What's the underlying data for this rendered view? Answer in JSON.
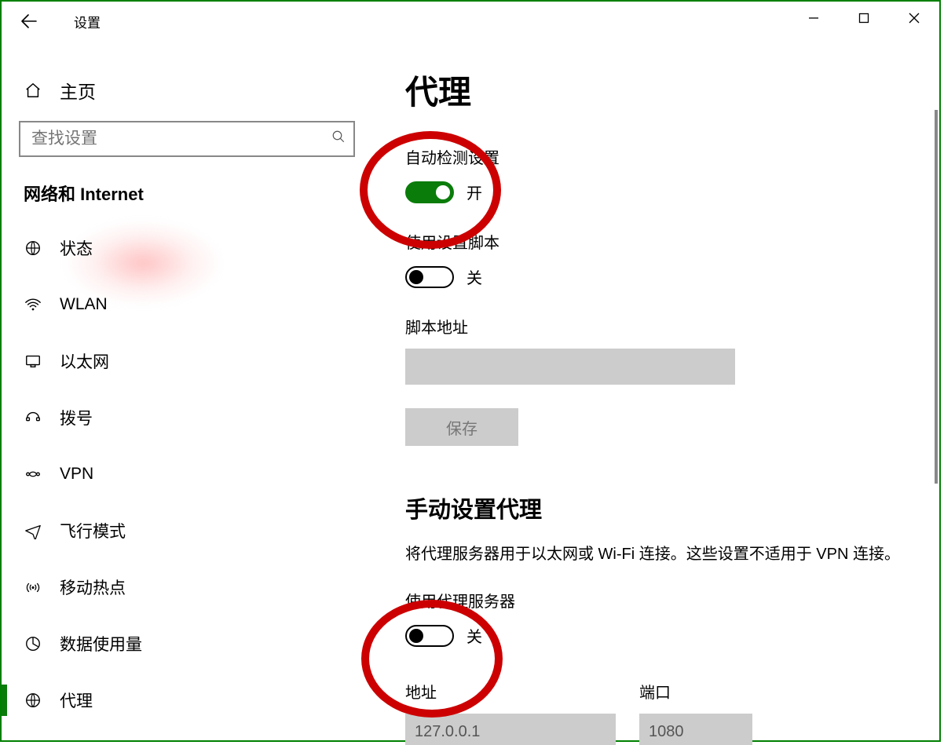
{
  "window": {
    "title": "设置"
  },
  "sidebar": {
    "home": "主页",
    "search_placeholder": "查找设置",
    "category": "网络和 Internet",
    "items": [
      {
        "label": "状态",
        "icon": "status-icon"
      },
      {
        "label": "WLAN",
        "icon": "wifi-icon"
      },
      {
        "label": "以太网",
        "icon": "ethernet-icon"
      },
      {
        "label": "拨号",
        "icon": "dialup-icon"
      },
      {
        "label": "VPN",
        "icon": "vpn-icon"
      },
      {
        "label": "飞行模式",
        "icon": "airplane-icon"
      },
      {
        "label": "移动热点",
        "icon": "hotspot-icon"
      },
      {
        "label": "数据使用量",
        "icon": "datausage-icon"
      },
      {
        "label": "代理",
        "icon": "proxy-icon",
        "active": true
      }
    ]
  },
  "content": {
    "page_title": "代理",
    "auto_detect_label": "自动检测设置",
    "auto_detect_state_text": "开",
    "use_script_label": "使用设置脚本",
    "use_script_state_text": "关",
    "script_address_label": "脚本地址",
    "script_address_value": "",
    "save_label": "保存",
    "manual_title": "手动设置代理",
    "manual_desc": "将代理服务器用于以太网或 Wi-Fi 连接。这些设置不适用于 VPN 连接。",
    "use_proxy_label": "使用代理服务器",
    "use_proxy_state_text": "关",
    "address_label": "地址",
    "address_value": "127.0.0.1",
    "port_label": "端口",
    "port_value": "1080"
  }
}
